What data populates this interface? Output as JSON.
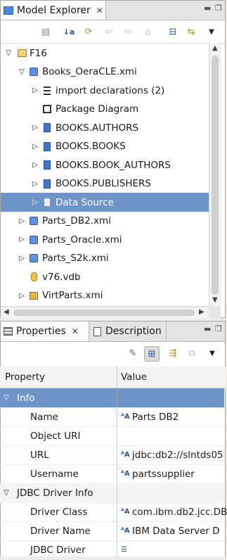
{
  "explorer": {
    "tab_label": "Model Explorer",
    "tree": [
      {
        "label": "F16",
        "twisty": "open",
        "icon": "project-icon"
      },
      {
        "label": "Books_OeraCLE.xmi",
        "twisty": "open",
        "icon": "model-icon"
      },
      {
        "label": "import declarations (2)",
        "twisty": "closed",
        "icon": "import-icon"
      },
      {
        "label": "Package Diagram",
        "twisty": "none",
        "icon": "diagram-icon"
      },
      {
        "label": "BOOKS.AUTHORS",
        "twisty": "closed",
        "icon": "table-icon"
      },
      {
        "label": "BOOKS.BOOKS",
        "twisty": "closed",
        "icon": "table-icon"
      },
      {
        "label": "BOOKS.BOOK_AUTHORS",
        "twisty": "closed",
        "icon": "table-icon"
      },
      {
        "label": "BOOKS.PUBLISHERS",
        "twisty": "closed",
        "icon": "table-icon"
      },
      {
        "label": "Data Source",
        "twisty": "closed",
        "icon": "datasource-icon"
      },
      {
        "label": "Parts_DB2.xmi",
        "twisty": "closed",
        "icon": "model-icon"
      },
      {
        "label": "Parts_Oracle.xmi",
        "twisty": "closed",
        "icon": "model-icon"
      },
      {
        "label": "Parts_S2k.xmi",
        "twisty": "closed",
        "icon": "model-icon"
      },
      {
        "label": "v76.vdb",
        "twisty": "none",
        "icon": "vdb-icon"
      },
      {
        "label": "VirtParts.xmi",
        "twisty": "closed",
        "icon": "virtual-model-icon"
      }
    ]
  },
  "properties": {
    "tab_label": "Properties",
    "description_tab_label": "Description",
    "col_property": "Property",
    "col_value": "Value",
    "rows": [
      {
        "name": "Info",
        "value": "",
        "group": true
      },
      {
        "name": "Name",
        "value": "Parts DB2",
        "group": false
      },
      {
        "name": "Object URI",
        "value": "",
        "group": false
      },
      {
        "name": "URL",
        "value": "jdbc:db2://slntds05",
        "group": false
      },
      {
        "name": "Username",
        "value": "partssupplier",
        "group": false
      },
      {
        "name": "JDBC Driver Info",
        "value": "",
        "group": true
      },
      {
        "name": "Driver Class",
        "value": "com.ibm.db2.jcc.DB",
        "group": false
      },
      {
        "name": "Driver Name",
        "value": "IBM Data Server D",
        "group": false
      },
      {
        "name": "JDBC Driver",
        "value": "",
        "group": false
      }
    ]
  },
  "colors": {
    "selection": "#6f94c8",
    "background": "#edeceb"
  }
}
